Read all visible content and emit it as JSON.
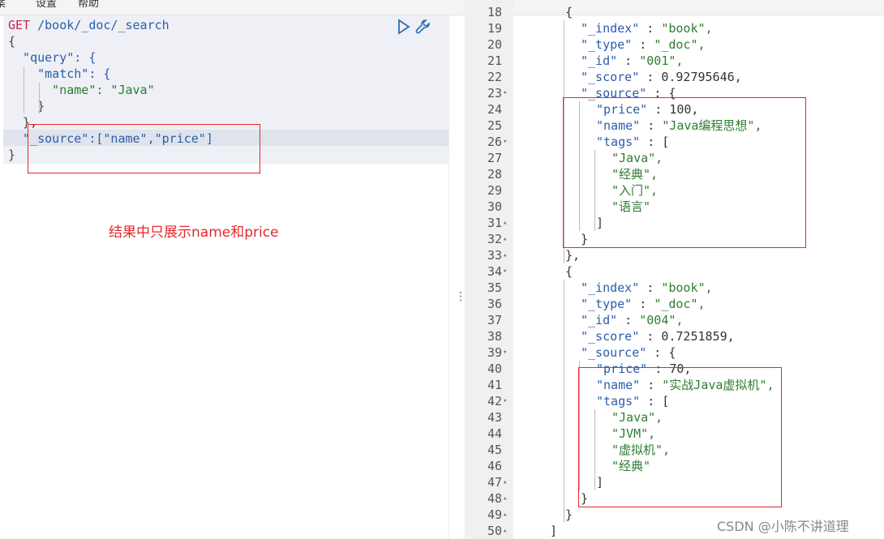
{
  "menubar": {
    "items": [
      "案",
      "设置",
      "帮助"
    ]
  },
  "request": {
    "method": "GET",
    "path": "/book/_doc/_search",
    "lines": [
      "{",
      "  \"query\": {",
      "    \"match\": {",
      "      \"name\": \"Java\"",
      "    }",
      "  },",
      "  \"_source\":[\"name\",\"price\"]",
      "}"
    ]
  },
  "annotation": "结果中只展示name和price",
  "response": {
    "line_numbers": [
      "18",
      "19",
      "20",
      "21",
      "22",
      "23",
      "24",
      "25",
      "26",
      "27",
      "28",
      "29",
      "30",
      "31",
      "32",
      "33",
      "34",
      "35",
      "36",
      "37",
      "38",
      "39",
      "40",
      "41",
      "42",
      "43",
      "44",
      "45",
      "46",
      "47",
      "48",
      "49",
      "50"
    ],
    "lines": [
      "{",
      "\"_index\" : \"book\",",
      "\"_type\" : \"_doc\",",
      "\"_id\" : \"001\",",
      "\"_score\" : 0.92795646,",
      "\"_source\" : {",
      "\"price\" : 100,",
      "\"name\" : \"Java编程思想\",",
      "\"tags\" : [",
      "\"Java\",",
      "\"经典\",",
      "\"入门\",",
      "\"语言\"",
      "]",
      "}",
      "},",
      "{",
      "\"_index\" : \"book\",",
      "\"_type\" : \"_doc\",",
      "\"_id\" : \"004\",",
      "\"_score\" : 0.7251859,",
      "\"_source\" : {",
      "\"price\" : 70,",
      "\"name\" : \"实战Java虚拟机\",",
      "\"tags\" : [",
      "\"Java\",",
      "\"JVM\",",
      "\"虚拟机\",",
      "\"经典\"",
      "]",
      "}",
      "}",
      "]"
    ]
  },
  "watermark": "CSDN @小陈不讲道理",
  "colors": {
    "annotation_red": "#e8262a",
    "key_blue": "#2a5dab",
    "string_green": "#2e7d32"
  },
  "icons": [
    "play-icon",
    "wrench-icon"
  ]
}
